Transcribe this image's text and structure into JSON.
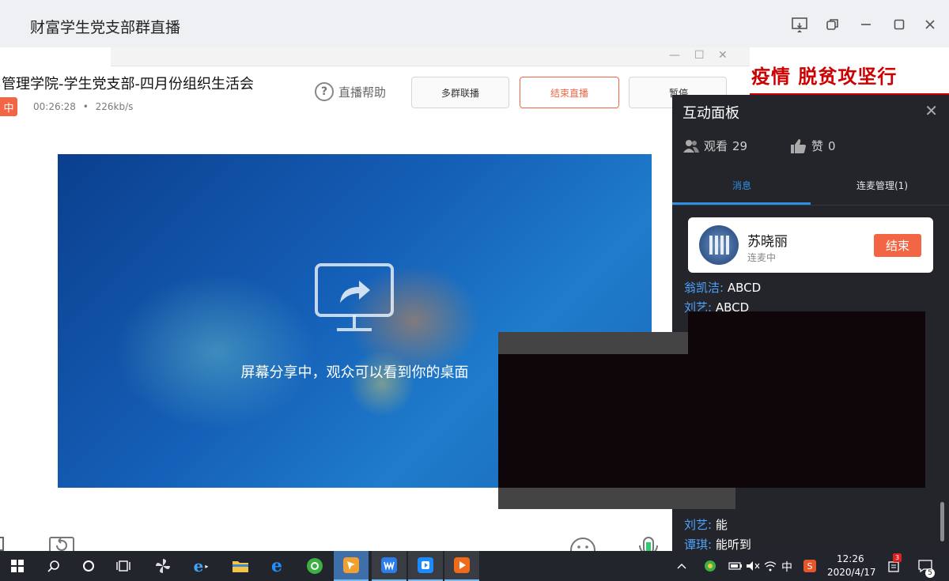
{
  "window": {
    "title": "财富学生党支部群直播"
  },
  "live": {
    "title": "管理学院-学生党支部-四月份组织生活会",
    "badge": "中",
    "duration": "00:26:28",
    "bitrate": "226kb/s",
    "help": "直播帮助",
    "buttons": {
      "multi_group": "多群联播",
      "end": "结束直播",
      "pause": "暂停"
    },
    "share_text": "屏幕分享中，观众可以看到你的桌面"
  },
  "banner": {
    "text": "疫情  脱贫攻坚行"
  },
  "panel": {
    "title": "互动面板",
    "viewers_label": "观看",
    "viewers_count": "29",
    "likes_label": "赞",
    "likes_count": "0",
    "tabs": {
      "messages": "消息",
      "mic": "连麦管理(1)"
    },
    "card": {
      "name": "苏晓丽",
      "status": "连麦中",
      "end_button": "结束"
    },
    "messages_top": [
      {
        "name": "翁凯洁:",
        "text": "ABCD"
      },
      {
        "name": "刘艺:",
        "text": "ABCD"
      }
    ],
    "messages_bottom": [
      {
        "name": "刘艺:",
        "text": "能"
      },
      {
        "name": "谭琪:",
        "text": "能听到"
      }
    ]
  },
  "taskbar": {
    "ime": "中",
    "time": "12:26",
    "date": "2020/4/17",
    "notification_count": "3",
    "action_center_count": "5"
  },
  "colors": {
    "accent_red": "#f26646",
    "panel_bg": "#24252a",
    "link_blue": "#4da3ff",
    "tab_blue": "#2f8fe8"
  }
}
